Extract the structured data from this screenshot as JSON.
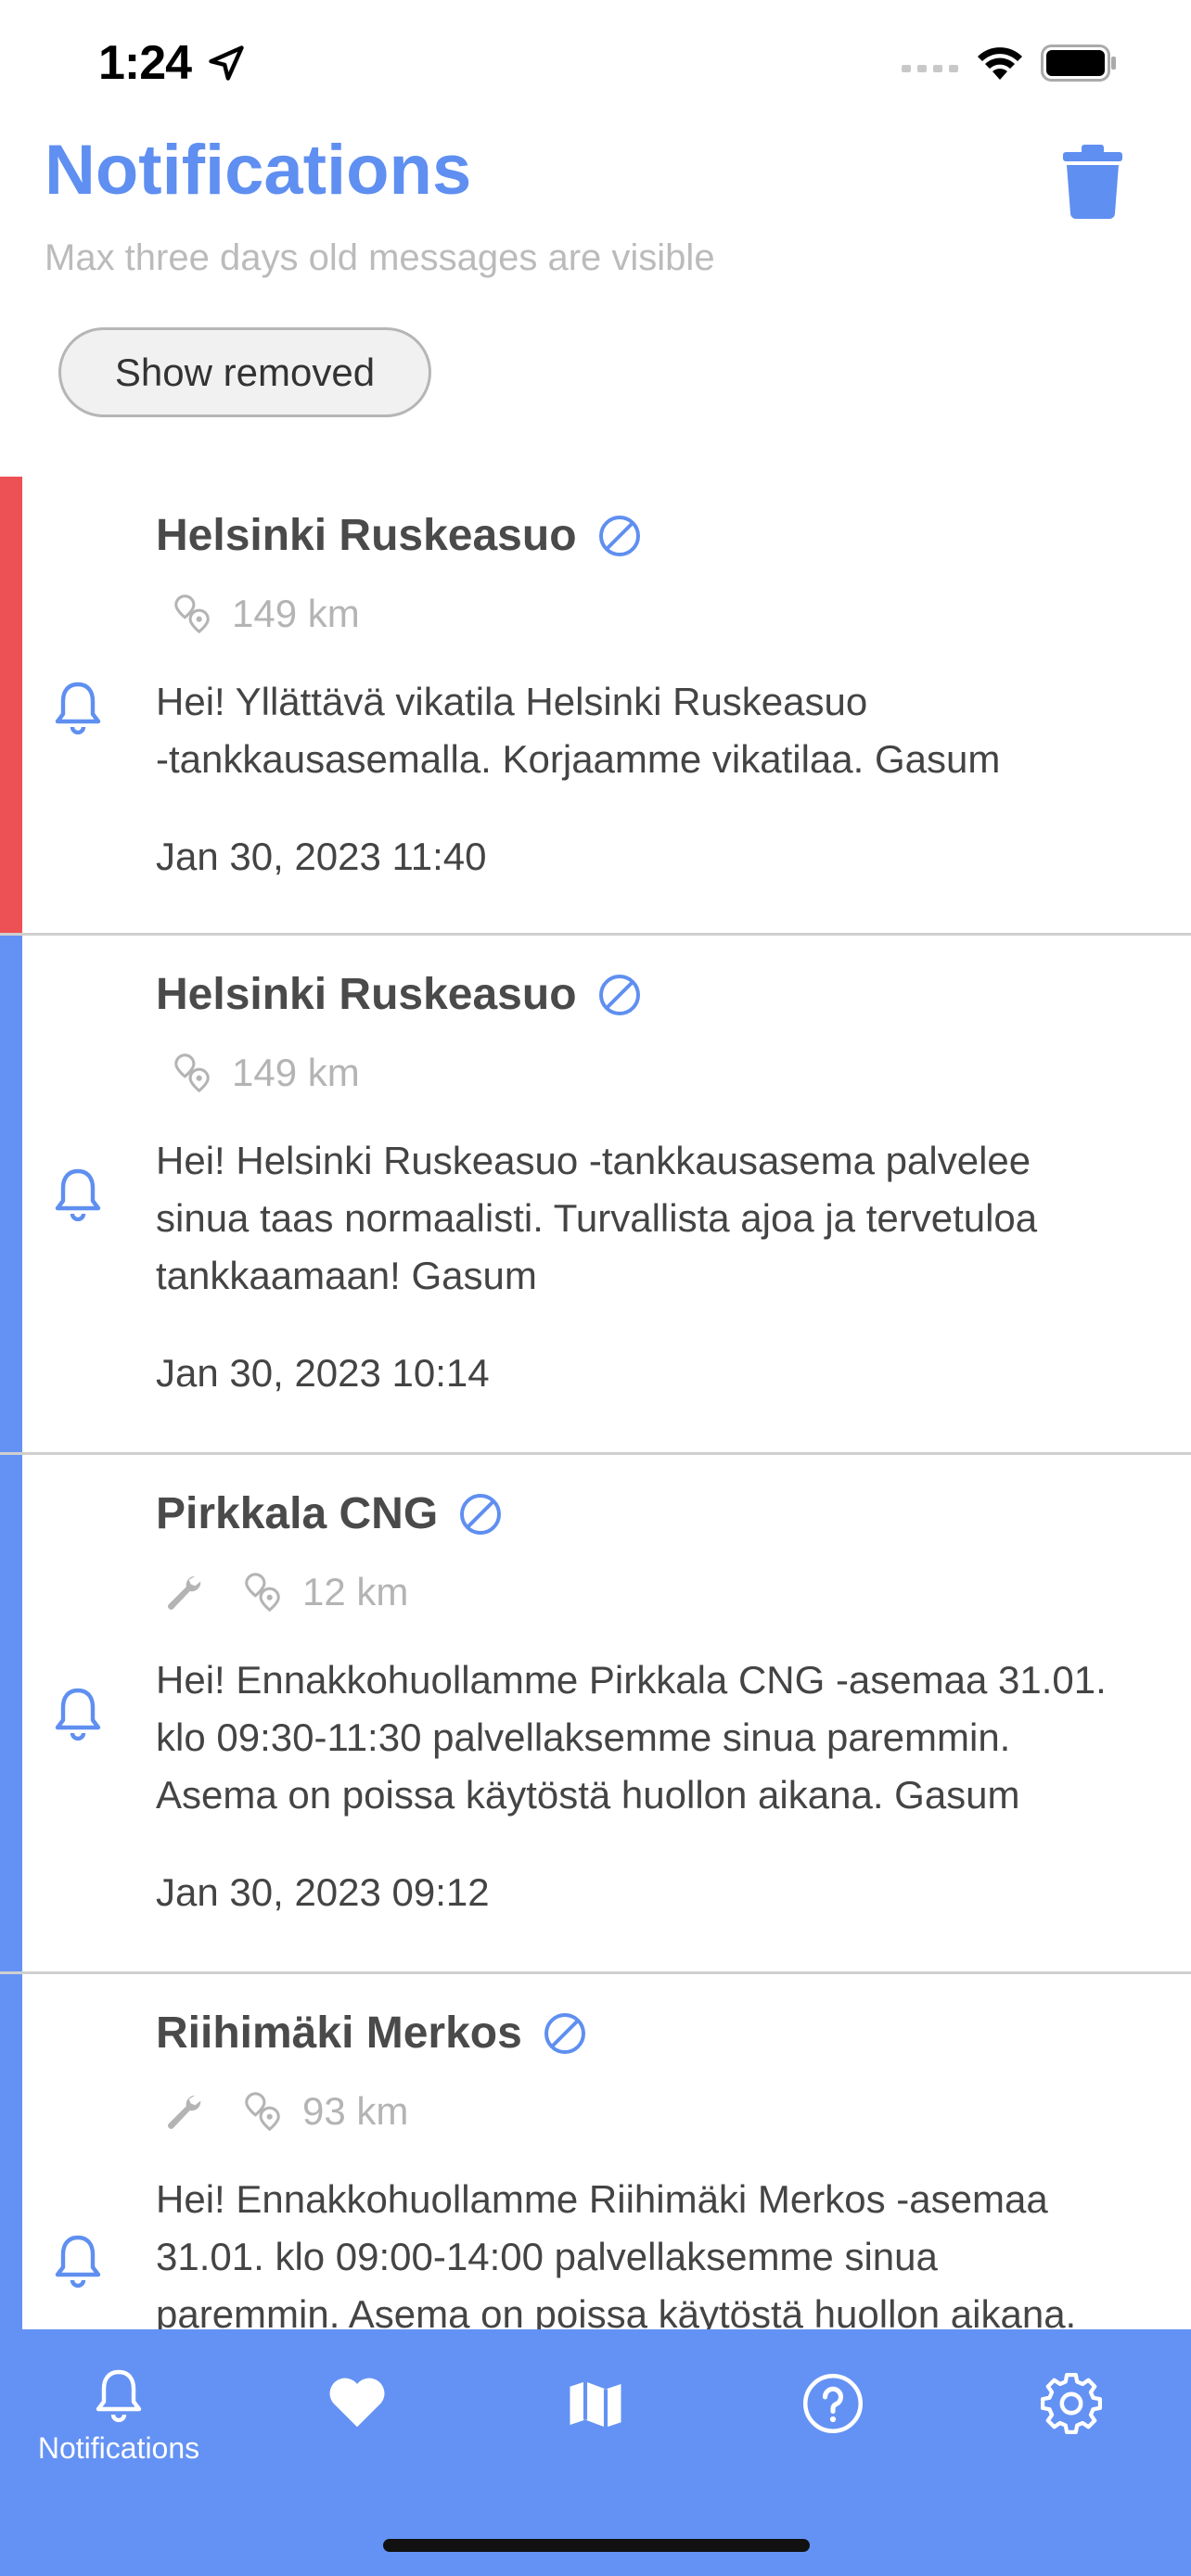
{
  "status": {
    "time": "1:24"
  },
  "header": {
    "title": "Notifications",
    "subtitle": "Max three days old messages are visible",
    "show_removed_label": "Show removed"
  },
  "colors": {
    "accent": "#5f8ff0",
    "alert_stripe": "#ee5155",
    "info_stripe": "#6492f4",
    "tabbar": "#6492f4"
  },
  "notifications": [
    {
      "station": "Helsinki Ruskeasuo",
      "has_maintenance_icon": false,
      "distance": "149 km",
      "message": "Hei! Yllättävä vikatila Helsinki Ruskeasuo\n-tankkausasemalla. Korjaamme vikatilaa. Gasum",
      "date": "Jan 30, 2023 11:40",
      "severity": "alert"
    },
    {
      "station": "Helsinki Ruskeasuo",
      "has_maintenance_icon": false,
      "distance": "149 km",
      "message": "Hei! Helsinki Ruskeasuo -tankkausasema palvelee\nsinua taas normaalisti. Turvallista ajoa ja tervetuloa\ntankkaamaan! Gasum",
      "date": "Jan 30, 2023 10:14",
      "severity": "info"
    },
    {
      "station": "Pirkkala CNG",
      "has_maintenance_icon": true,
      "distance": "12 km",
      "message": "Hei! Ennakkohuollamme Pirkkala CNG -asemaa 31.01.\nklo 09:30-11:30 palvellaksemme sinua paremmin.\nAsema on poissa käytöstä huollon aikana. Gasum",
      "date": "Jan 30, 2023 09:12",
      "severity": "info"
    },
    {
      "station": "Riihimäki Merkos",
      "has_maintenance_icon": true,
      "distance": "93 km",
      "message": "Hei! Ennakkohuollamme Riihimäki Merkos -asemaa\n31.01. klo 09:00-14:00 palvellaksemme sinua\nparemmin. Asema on poissa käytöstä huollon aikana.",
      "date": "",
      "severity": "info"
    }
  ],
  "tabbar": {
    "tabs": [
      {
        "label": "Notifications",
        "icon": "bell-icon",
        "active": true
      },
      {
        "label": "",
        "icon": "heart-icon",
        "active": false
      },
      {
        "label": "",
        "icon": "map-icon",
        "active": false
      },
      {
        "label": "",
        "icon": "help-icon",
        "active": false
      },
      {
        "label": "",
        "icon": "gear-icon",
        "active": false
      }
    ]
  }
}
